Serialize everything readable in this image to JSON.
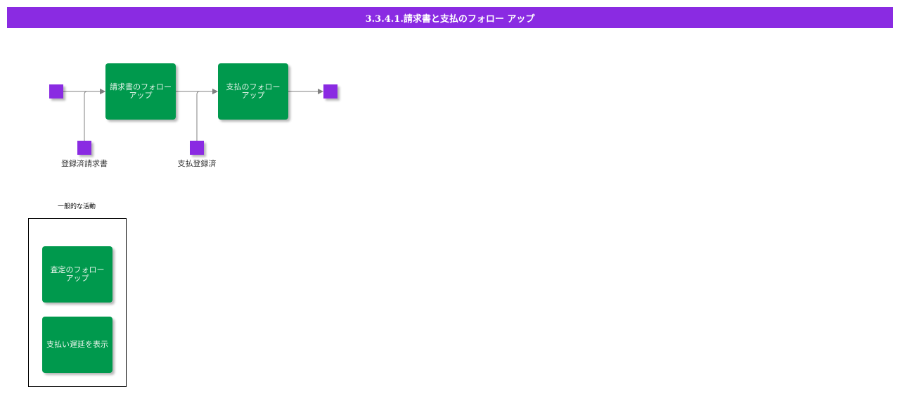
{
  "title": "3.3.4.1.請求書と支払のフォロー アップ",
  "colors": {
    "title_bar": "#8a2be2",
    "activity": "#00994d",
    "event_node": "#8a2be2",
    "connector": "#808080"
  },
  "flow": {
    "activities": [
      {
        "id": "a1",
        "label": "請求書のフォロー アップ"
      },
      {
        "id": "a2",
        "label": "支払のフォロー アップ"
      }
    ],
    "inputs": [
      {
        "id": "i1",
        "label": "登録済請求書"
      },
      {
        "id": "i2",
        "label": "支払登録済"
      }
    ]
  },
  "group": {
    "label": "一般的な活動",
    "activities": [
      {
        "label": "査定のフォロー アップ"
      },
      {
        "label": "支払い遅延を表示"
      }
    ]
  }
}
